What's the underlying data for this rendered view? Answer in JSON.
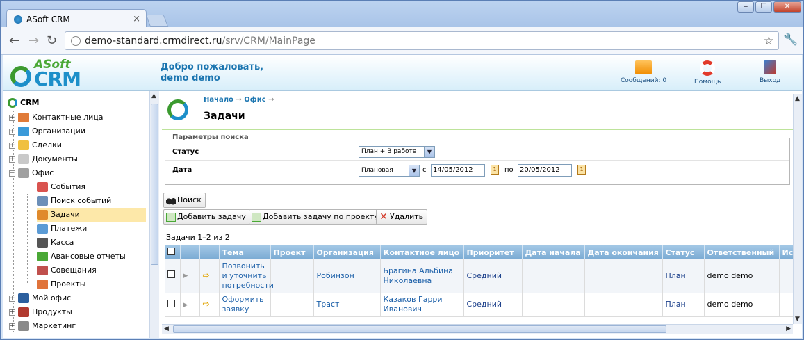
{
  "browser": {
    "tab_title": "ASoft CRM",
    "url_host": "demo-standard.crmdirect.ru",
    "url_path": "/srv/CRM/MainPage",
    "controls": {
      "minimize": "‒",
      "maximize": "☐",
      "close": "✕"
    }
  },
  "header": {
    "logo_top": "ASoft",
    "logo_bottom": "CRM",
    "welcome_line1": "Добро пожаловать,",
    "welcome_line2": "demo demo",
    "messages_label": "Сообщений: 0",
    "help_label": "Помощь",
    "exit_label": "Выход"
  },
  "sidebar": {
    "root": "CRM",
    "items": [
      {
        "label": "Контактные лица",
        "icon": "contacts-icon",
        "color": "#e07b39"
      },
      {
        "label": "Организации",
        "icon": "organizations-icon",
        "color": "#3a9ad9"
      },
      {
        "label": "Сделки",
        "icon": "deals-icon",
        "color": "#f0c040"
      },
      {
        "label": "Документы",
        "icon": "documents-icon",
        "color": "#c9c9c9"
      },
      {
        "label": "Офис",
        "icon": "office-icon",
        "color": "#a0a0a0"
      }
    ],
    "office_children": [
      {
        "label": "События",
        "icon": "events-icon",
        "color": "#d9534f"
      },
      {
        "label": "Поиск событий",
        "icon": "search-events-icon",
        "color": "#6c8fb8"
      },
      {
        "label": "Задачи",
        "icon": "tasks-icon",
        "color": "#e08a2c"
      },
      {
        "label": "Платежи",
        "icon": "payments-icon",
        "color": "#5b9bd5"
      },
      {
        "label": "Касса",
        "icon": "cashbox-icon",
        "color": "#555555"
      },
      {
        "label": "Авансовые отчеты",
        "icon": "advance-reports-icon",
        "color": "#4aa836"
      },
      {
        "label": "Совещания",
        "icon": "meetings-icon",
        "color": "#c0504d"
      },
      {
        "label": "Проекты",
        "icon": "projects-icon",
        "color": "#e0733a"
      }
    ],
    "tail_items": [
      {
        "label": "Мой офис",
        "icon": "my-office-icon",
        "color": "#2c5f9e"
      },
      {
        "label": "Продукты",
        "icon": "products-icon",
        "color": "#b13a2f"
      },
      {
        "label": "Маркетинг",
        "icon": "marketing-icon",
        "color": "#8a8a8a"
      }
    ]
  },
  "page": {
    "breadcrumb_home": "Начало",
    "breadcrumb_office": "Офис",
    "breadcrumb_sep": "→",
    "title": "Задачи"
  },
  "search": {
    "legend": "Параметры поиска",
    "status_label": "Статус",
    "status_value": "План + В работе",
    "date_label": "Дата",
    "date_type": "Плановая",
    "from_label": "с",
    "from_value": "14/05/2012",
    "to_label": "по",
    "to_value": "20/05/2012",
    "search_button": "Поиск"
  },
  "toolbar": {
    "add_task": "Добавить задачу",
    "add_task_project": "Добавить задачу по проекту",
    "delete": "Удалить"
  },
  "table": {
    "count": "Задачи 1–2 из 2",
    "columns": [
      "Тема",
      "Проект",
      "Организация",
      "Контактное лицо",
      "Приоритет",
      "Дата начала",
      "Дата окончания",
      "Статус",
      "Ответственный",
      "Ис"
    ],
    "rows": [
      {
        "topic": "Позвонить и уточнить потребности",
        "project": "",
        "org": "Робинзон",
        "contact": "Брагина Альбина Николаевна",
        "priority": "Средний",
        "start": "",
        "end": "",
        "status": "План",
        "owner": "demo demo"
      },
      {
        "topic": "Оформить заявку",
        "project": "",
        "org": "Траст",
        "contact": "Казаков Гарри Иванович",
        "priority": "Средний",
        "start": "",
        "end": "",
        "status": "План",
        "owner": "demo demo"
      }
    ]
  }
}
